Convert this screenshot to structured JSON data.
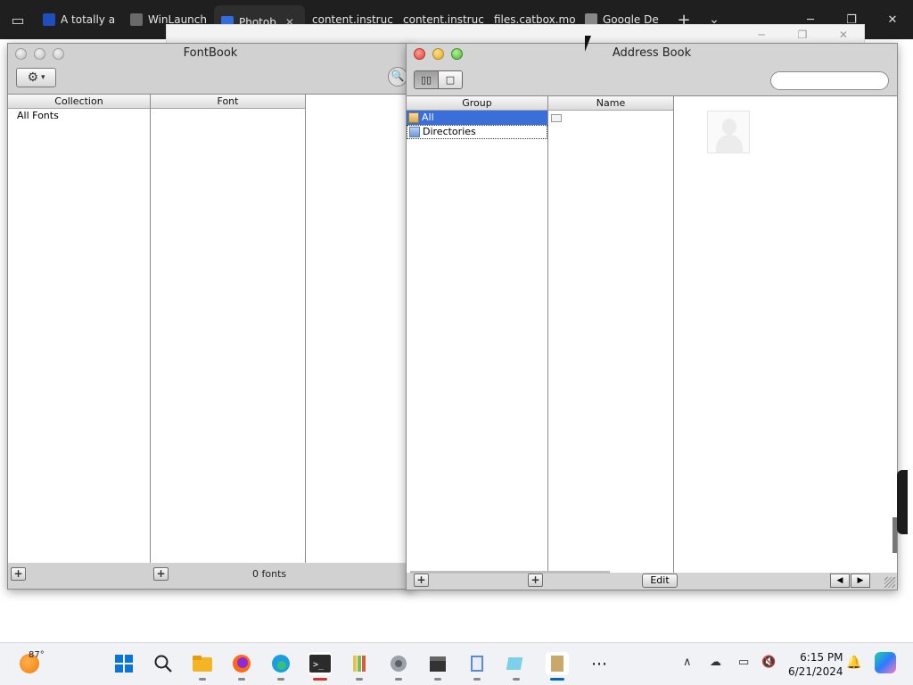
{
  "browser": {
    "tabs": [
      {
        "label": "A totally a",
        "color": "#1f4fbf"
      },
      {
        "label": "WinLaunch",
        "color": "#6a6a6a"
      },
      {
        "label": "Photob",
        "color": "#2f6de0",
        "active": true
      },
      {
        "label": "content.instruc",
        "color": ""
      },
      {
        "label": "content.instruc",
        "color": ""
      },
      {
        "label": "files.catbox.mo",
        "color": ""
      },
      {
        "label": "Google De",
        "color": "#888"
      }
    ],
    "close_glyph": "✕",
    "new_tab_glyph": "+",
    "dropdown_glyph": "⌄",
    "minimize_glyph": "─",
    "restore_glyph": "❐",
    "window_close_glyph": "✕"
  },
  "fontbook": {
    "title": "FontBook",
    "gear_icon": "⚙",
    "caret": "▾",
    "columns": {
      "collection": "Collection",
      "font": "Font"
    },
    "collections": [
      "All Fonts"
    ],
    "add_glyph": "+",
    "font_count": "0 fonts",
    "search_glyph": "🔍"
  },
  "addressbook": {
    "title": "Address Book",
    "columns": {
      "group": "Group",
      "name": "Name"
    },
    "groups": [
      {
        "label": "All",
        "selected": true
      },
      {
        "label": "Directories",
        "selected": false
      }
    ],
    "search_value": "",
    "view_icons": {
      "columns": "▯▯",
      "card": "□"
    },
    "add_glyph": "+",
    "edit_label": "Edit",
    "prev_glyph": "◀",
    "next_glyph": "▶"
  },
  "taskbar": {
    "temperature": "87°",
    "time": "6:15 PM",
    "date": "6/21/2024",
    "icons": [
      "windows-start",
      "search",
      "file-explorer",
      "firefox",
      "edge",
      "terminal",
      "paint-brush",
      "media",
      "clapper",
      "book",
      "notepad",
      "fontbook"
    ],
    "more_glyph": "⋯",
    "chevron_glyph": "∧"
  }
}
